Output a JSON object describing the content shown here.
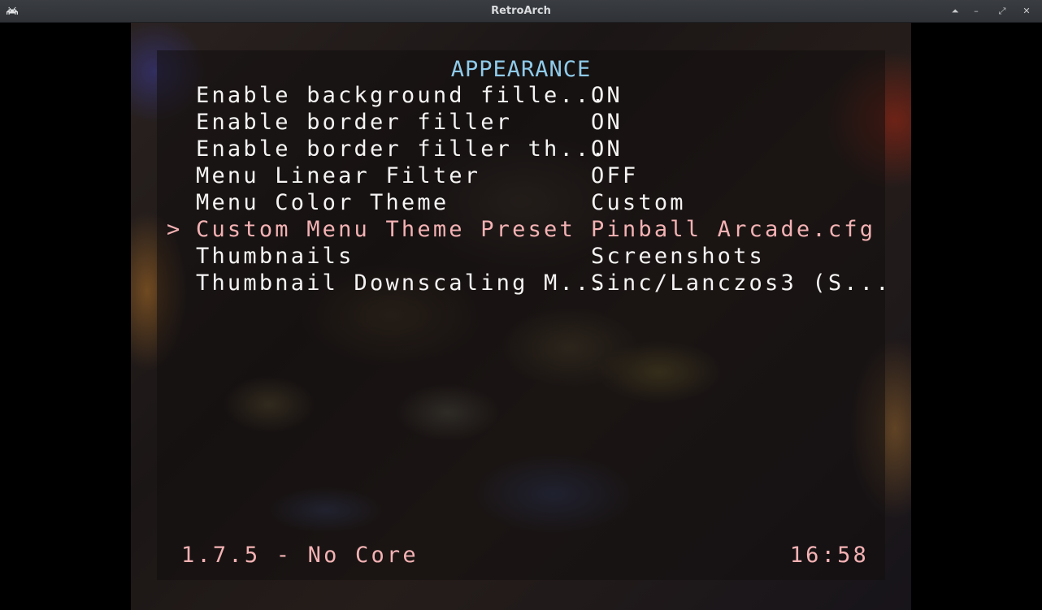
{
  "window": {
    "title": "RetroArch",
    "icon": "space-invader-icon",
    "buttons": [
      {
        "name": "keep-above",
        "glyph": "⏶"
      },
      {
        "name": "minimize",
        "glyph": "–"
      },
      {
        "name": "maximize",
        "glyph": "⤢"
      },
      {
        "name": "close",
        "glyph": "✕"
      }
    ]
  },
  "menu": {
    "title": "APPEARANCE",
    "cursor_glyph": ">",
    "items": [
      {
        "label": "Enable background fille...",
        "value": "ON"
      },
      {
        "label": "Enable border filler",
        "value": "ON"
      },
      {
        "label": "Enable border filler th...",
        "value": "ON"
      },
      {
        "label": "Menu Linear Filter",
        "value": "OFF"
      },
      {
        "label": "Menu Color Theme",
        "value": "Custom"
      },
      {
        "label": "Custom Menu Theme Preset",
        "value": "Pinball Arcade.cfg",
        "selected": true
      },
      {
        "label": "Thumbnails",
        "value": "Screenshots"
      },
      {
        "label": "Thumbnail Downscaling M...",
        "value": "Sinc/Lanczos3 (S..."
      }
    ]
  },
  "footer": {
    "version_core": "1.7.5 - No Core",
    "clock": "16:58"
  },
  "colors": {
    "title": "#8fcbea",
    "normal_text": "#f5f3f3",
    "selected_text": "#f4b2b4",
    "titlebar": "#2f3236"
  }
}
